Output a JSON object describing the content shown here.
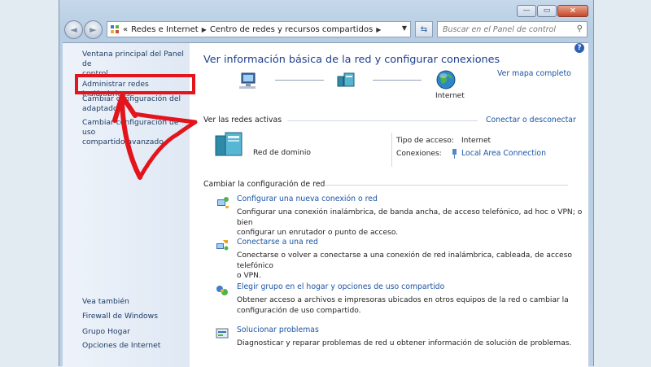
{
  "window": {
    "caption_buttons": {
      "minimize": "—",
      "maximize": "▭",
      "close": "✕"
    }
  },
  "nav": {
    "back_glyph": "◄",
    "forward_glyph": "►",
    "overflow": "«",
    "breadcrumbs": [
      "Redes e Internet",
      "Centro de redes y recursos compartidos"
    ],
    "search_placeholder": "Buscar en el Panel de control"
  },
  "sidebar": {
    "links": [
      {
        "label1": "Ventana principal del Panel de",
        "label2": "control"
      },
      {
        "label1": "Administrar redes inalámbricas",
        "label2": ""
      },
      {
        "label1": "Cambiar configuración del",
        "label2": "adaptador"
      },
      {
        "label1": "Cambiar configuración de uso",
        "label2": "compartido avanzado"
      }
    ],
    "see_also": "Vea también",
    "see_also_links": [
      "Firewall de Windows",
      "Grupo Hogar",
      "Opciones de Internet"
    ]
  },
  "main": {
    "title": "Ver información básica de la red y configurar conexiones",
    "map_link": "Ver mapa completo",
    "internet_label": "Internet",
    "active_header": "Ver las redes activas",
    "connect_link": "Conectar o desconectar",
    "network_name": "Red de dominio",
    "access_type_label": "Tipo de acceso:",
    "access_type_value": "Internet",
    "connections_label": "Conexiones:",
    "connections_value": "Local Area Connection",
    "change_header": "Cambiar la configuración de red",
    "tasks": [
      {
        "title": "Configurar una nueva conexión o red",
        "desc1": "Configurar una conexión inalámbrica, de banda ancha, de acceso telefónico, ad hoc o VPN; o bien",
        "desc2": "configurar un enrutador o punto de acceso."
      },
      {
        "title": "Conectarse a una red",
        "desc1": "Conectarse o volver a conectarse a una conexión de red inalámbrica, cableada, de acceso telefónico",
        "desc2": "o VPN."
      },
      {
        "title": "Elegir grupo en el hogar y opciones de uso compartido",
        "desc1": "Obtener acceso a archivos e impresoras ubicados en otros equipos de la red o cambiar la",
        "desc2": "configuración de uso compartido."
      },
      {
        "title": "Solucionar problemas",
        "desc1": "Diagnosticar y reparar problemas de red u obtener información de solución de problemas.",
        "desc2": ""
      }
    ]
  },
  "annotation": {
    "highlight_color": "#e3141c"
  }
}
